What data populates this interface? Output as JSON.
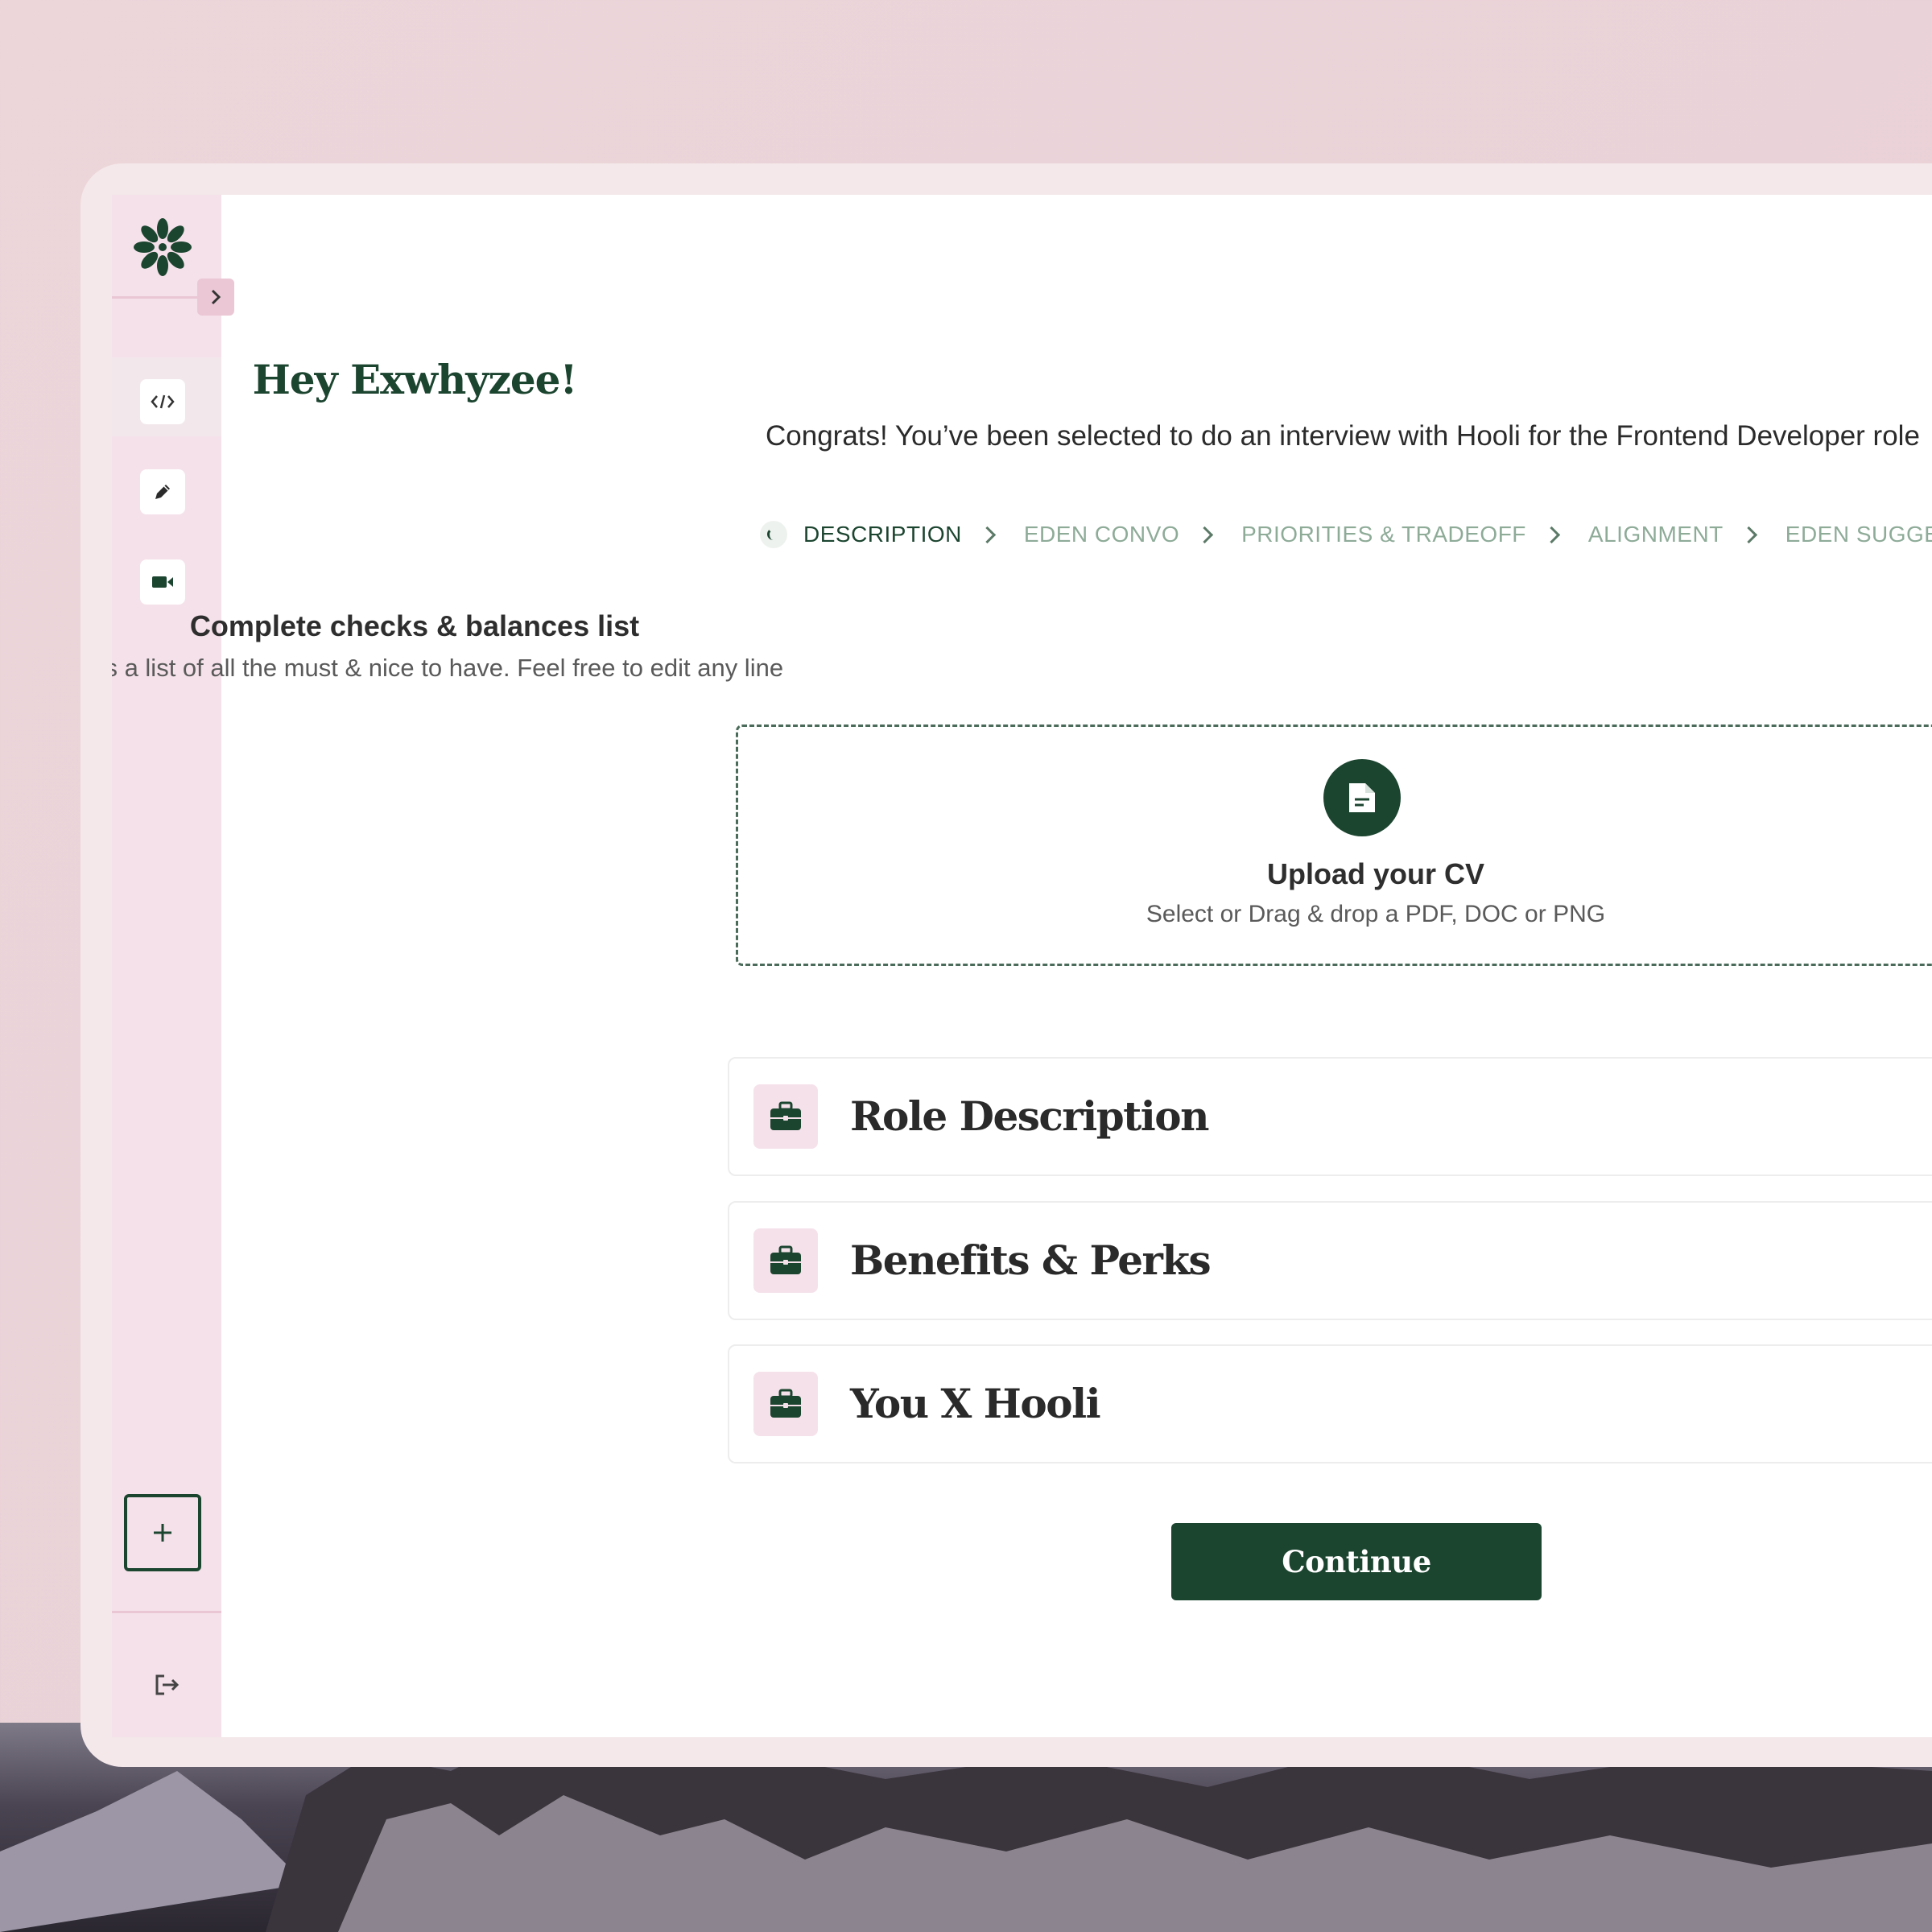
{
  "header": {
    "title": "Hey Exwhyzee!",
    "subtitle": "Congrats! You’ve been selected to do an interview with Hooli for the Frontend Developer role"
  },
  "steps": [
    {
      "label": "DESCRIPTION",
      "state": "active"
    },
    {
      "label": "EDEN CONVO",
      "state": "inactive"
    },
    {
      "label": "PRIORITIES & TRADEOFF",
      "state": "inactive"
    },
    {
      "label": "ALIGNMENT",
      "state": "inactive"
    },
    {
      "label": "EDEN SUGGESTIONS",
      "state": "inactive"
    }
  ],
  "checks": {
    "title": "Complete checks & balances list",
    "subtitle": "Here’s a list of all the must & nice to have. Feel free to edit any line"
  },
  "upload": {
    "title": "Upload your CV",
    "subtitle": "Select or Drag & drop a PDF, DOC or PNG",
    "icon": "document-icon"
  },
  "sections": [
    {
      "label": "Role Description",
      "icon": "briefcase-icon"
    },
    {
      "label": "Benefits & Perks",
      "icon": "briefcase-icon"
    },
    {
      "label": "You X Hooli",
      "icon": "briefcase-icon"
    }
  ],
  "actions": {
    "continue_label": "Continue"
  },
  "sidebar": {
    "logo": "eden-logo",
    "items": [
      {
        "icon": "code-icon",
        "active": true
      },
      {
        "icon": "pencil-icon",
        "active": false
      },
      {
        "icon": "video-camera-icon",
        "active": false
      }
    ],
    "add_icon": "plus-icon",
    "logout_icon": "logout-icon"
  },
  "colors": {
    "brand": "#1c4530",
    "sidebar_bg": "#f5e1ea",
    "step_inactive": "#8eab98",
    "page_bg": "#ecd6da"
  }
}
